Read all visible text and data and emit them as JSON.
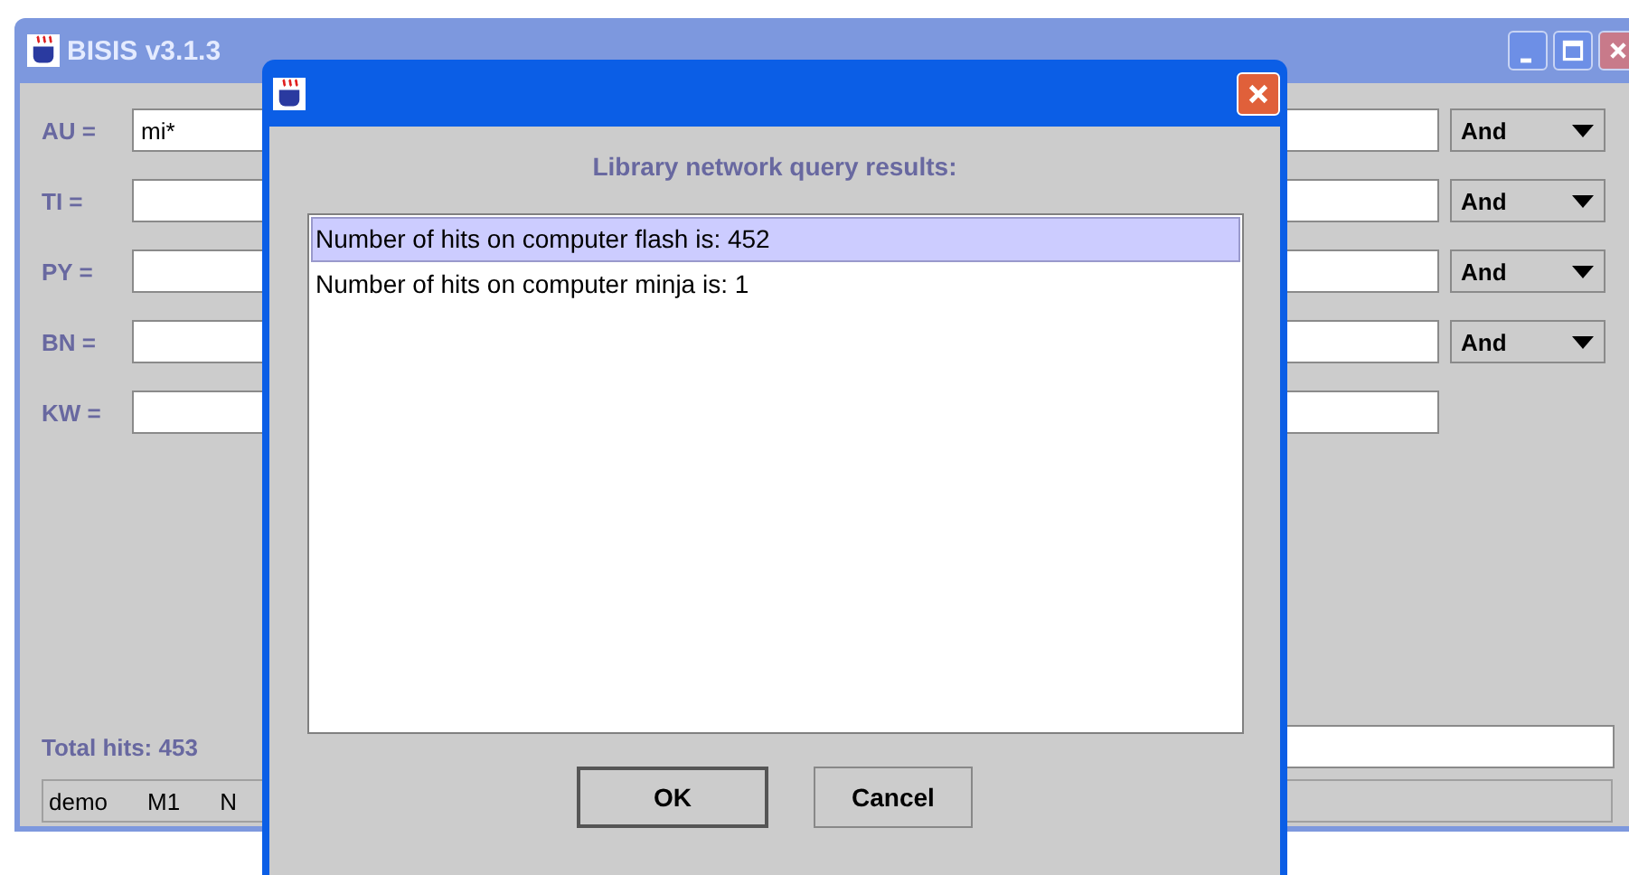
{
  "main_window": {
    "title": "BISIS v3.1.3",
    "fields": [
      {
        "label": "AU =",
        "value": "mi*",
        "operator": "And"
      },
      {
        "label": "TI =",
        "operator": "And"
      },
      {
        "label": "PY =",
        "operator": "And"
      },
      {
        "label": "BN =",
        "operator": "And"
      },
      {
        "label": "KW ="
      }
    ],
    "total_hits": "Total hits: 453",
    "status_bar": [
      "demo",
      "M1",
      "N"
    ]
  },
  "dialog": {
    "heading": "Library network query results:",
    "results": [
      {
        "text": "Number of hits on computer flash is: 452",
        "selected": true
      },
      {
        "text": "Number of hits on computer minja is: 1",
        "selected": false
      }
    ],
    "buttons": [
      {
        "label": "OK",
        "default": true
      },
      {
        "label": "Cancel",
        "default": false
      }
    ]
  }
}
